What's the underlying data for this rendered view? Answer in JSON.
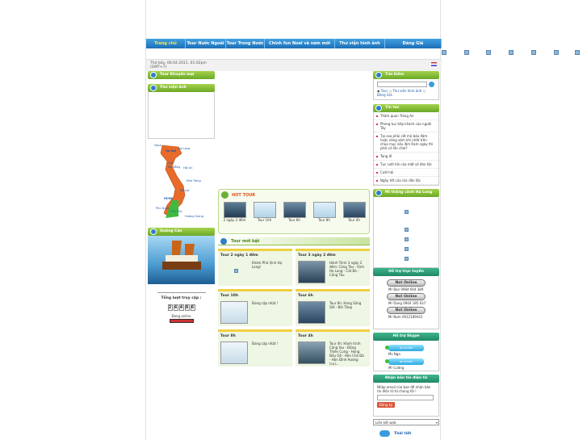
{
  "nav": [
    "Trang chủ",
    "Tour Nước Ngoài",
    "Tour Trong Nước",
    "Chinh fun Noel và năm mới 2011",
    "Thư viện hình ảnh",
    "Đăng Giá"
  ],
  "datebar": {
    "date": "Thứ bảy, 06.04.2011, 01:02pm",
    "tz": "(GMT+7)"
  },
  "left": {
    "tour_header": "Tour Khuyến mại",
    "library_header": "Thư viện ảnh",
    "map_labels": [
      "Sapa",
      "Hà Nội",
      "Hạ Long",
      "Huế",
      "Đà Nẵng",
      "Hội An",
      "Nha Trang",
      "Đà Lạt",
      "HCMC",
      "Phú Quốc",
      "Cần Thơ",
      "Hương Giang"
    ],
    "ads_header": "Quảng Cáo",
    "counter_title": "Tổng lượt truy cập :",
    "counter_digits": [
      "2",
      "4",
      "4",
      "8",
      "6"
    ],
    "online_label": "Đang online"
  },
  "hot": {
    "title": "HOT TOUR",
    "items": [
      "2 ngày 2 đêm",
      "Tour 10h",
      "Tour 6h",
      "Tour 8h",
      "Tour 4h"
    ]
  },
  "new_tours": {
    "title": "Tour mới bật",
    "cards": [
      {
        "title": "Tour 2 ngày 1 đêm",
        "desc": "Khám Phá Vịnh Hạ Long!"
      },
      {
        "title": "Tour 3 ngày 2 đêm",
        "desc": "Hành Trình 3 ngày 2 đêm: Cảng Tàu - Vịnh Hạ Long - Cát Bà - Cảng Tàu"
      },
      {
        "title": "Tour 10h",
        "desc": "Đang cập nhật !"
      },
      {
        "title": "Tour 6h",
        "desc": "Tour 6h: Hang Sửng Sốt - Bãi Titop"
      },
      {
        "title": "Tour 8h",
        "desc": "Đang cập nhật !"
      },
      {
        "title": "Tour 4h",
        "desc": "Tour 4h: Hành trình Cảng tàu - Động Thiên Cung - Hang Đầu Gỗ - Hòn Chó Đá - Hòn Đỉnh Hương (cu)..."
      }
    ]
  },
  "right": {
    "search_header": "Tìm kiếm",
    "search_options": [
      "Tour",
      "Thư viện hình ảnh",
      "Đăng Giá"
    ],
    "news_header": "Tin tức",
    "news": [
      "Thăm quan Tràng An",
      "Phong tục tiếp khách của người Tày",
      "Tại sao phải cất mũ bảo đảm hoặc xăng xăm khi nhất trên chùa mục nếu lãm Ram ngày thì phải có lần chơi?",
      "Tang lễ",
      "Tục cưới hỏi của một số dân tộc",
      "Cưới hỏi",
      "Ngày tết của các dân tộc"
    ],
    "scenery_header": "Mi thắng cảnh Hạ Long",
    "support_header": "Hỗ trợ trực tuyến",
    "support": [
      {
        "status": "Not Online",
        "line": "Mr Bạn 0984 604 389"
      },
      {
        "status": "Not Online",
        "line": "Mr Dong 0904 185 637"
      },
      {
        "status": "Not Online",
        "line": "Mr Nam 0912189441"
      }
    ],
    "skype_header": "Hỗ trợ Skype",
    "skype": [
      {
        "status": "on online",
        "name": "Ms Nga"
      },
      {
        "status": "on online",
        "name": "Mr Cường"
      }
    ],
    "newsletter_header": "Nhận bản tin điện tử",
    "newsletter_text": "Nhập email của bạn để nhận bản tin điện tử từ chúng tôi !",
    "newsletter_button": "Đăng ký",
    "links_select": "Liên kết web",
    "weather": "Thời tiết"
  }
}
